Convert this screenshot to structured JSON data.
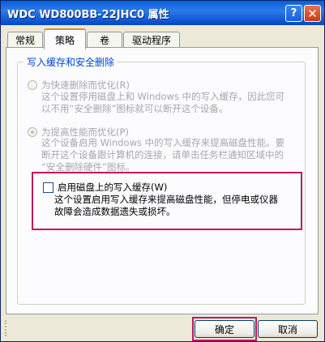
{
  "window": {
    "title": "WDC WD800BB-22JHC0 属性",
    "help_glyph": "?",
    "close_glyph": "✕"
  },
  "tabs": [
    {
      "label": "常规"
    },
    {
      "label": "策略",
      "active": true
    },
    {
      "label": "卷"
    },
    {
      "label": "驱动程序"
    }
  ],
  "group": {
    "label": "写入缓存和安全删除"
  },
  "options": [
    {
      "title": "为快速删除而优化(R)",
      "desc1": "这个设置停用磁盘上和 Windows 中的写入缓存，因此您可",
      "desc2": "以不用“安全删除”图标就可以断开这个设备。"
    },
    {
      "title": "为提高性能而优化(P)",
      "desc1": "这个设备启用 Windows 中的写入缓存来提高磁盘性能。要",
      "desc2": "断开这个设备跟计算机的连接，请单击任务栏通知区域中的",
      "desc3": "“安全删除硬件”图标。"
    }
  ],
  "write_cache": {
    "label": "启用磁盘上的写入缓存(W)",
    "desc1": "这个设置启用写入缓存来提高磁盘性能，但停电或仪器",
    "desc2": "故障会造成数据遗失或损坏。",
    "checked": false
  },
  "buttons": {
    "ok": "确定",
    "cancel": "取消"
  },
  "colors": {
    "title_bar": "#0a5fd7",
    "group_label": "#0046d5",
    "highlight": "#c2185b"
  }
}
